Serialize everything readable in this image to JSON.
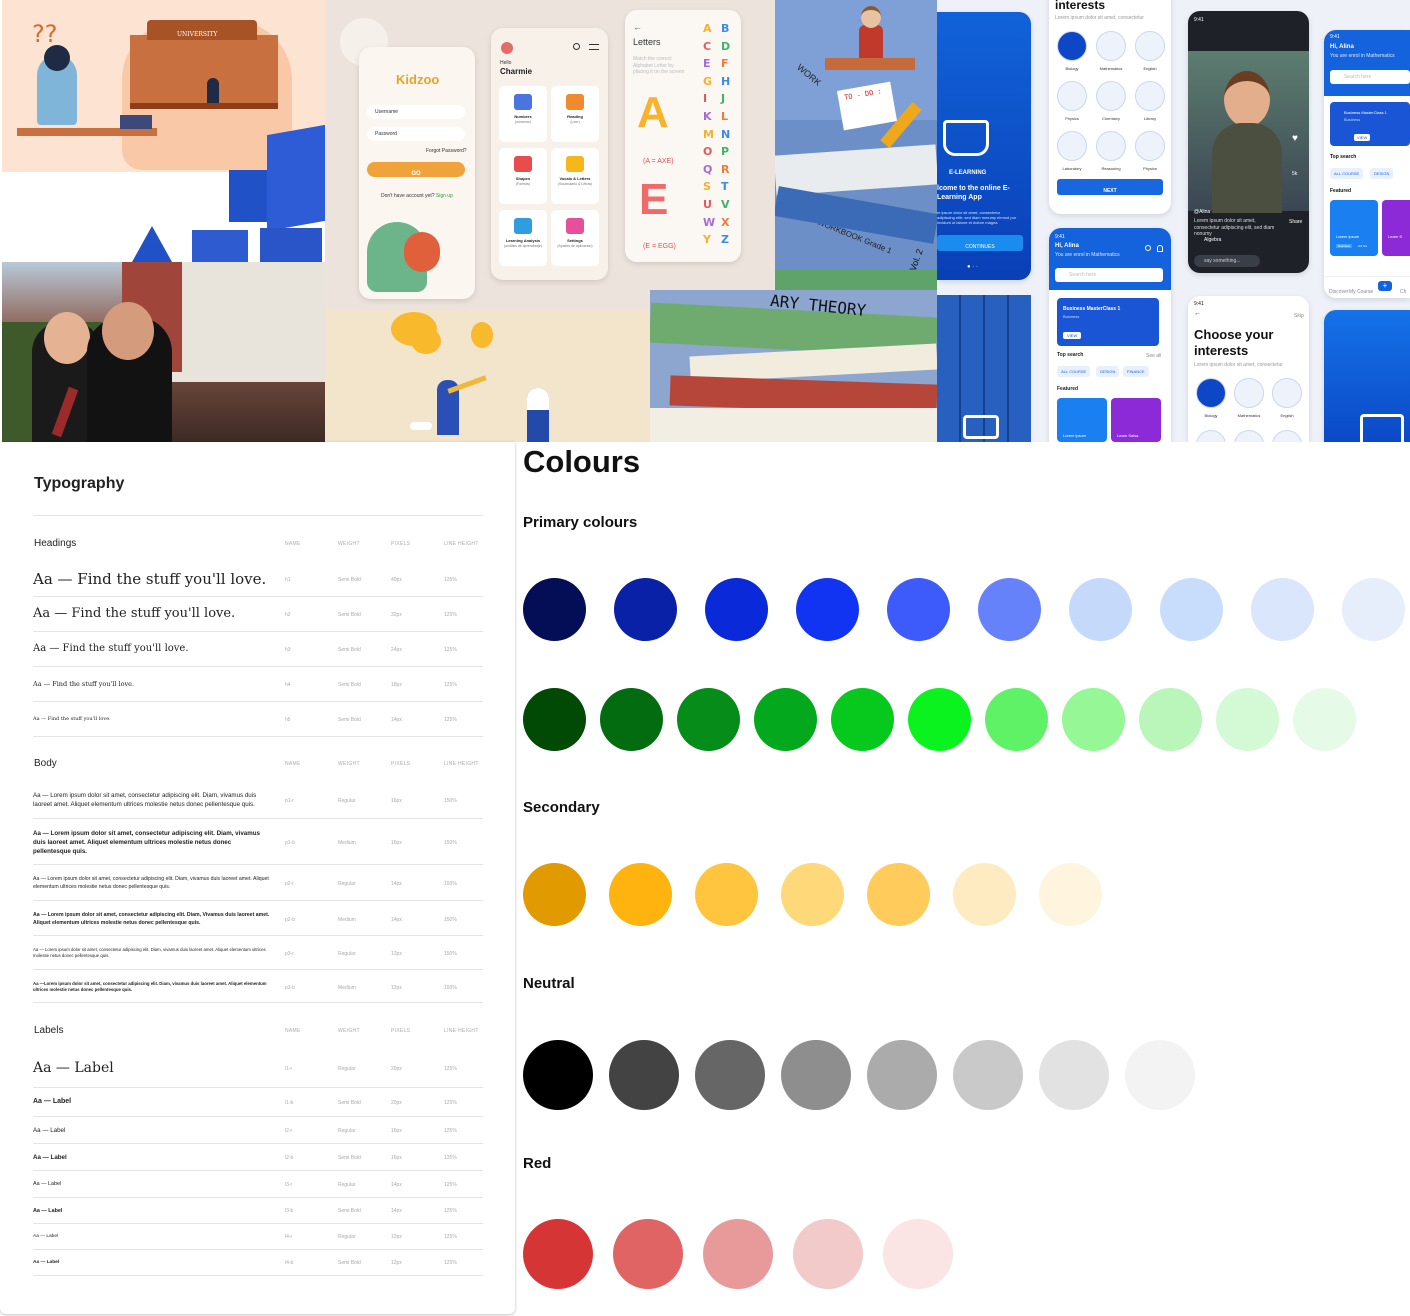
{
  "collage": {
    "university_sign": "UNIVERSITY",
    "kidzoo": {
      "logo": "Kidzoo",
      "username": "Username",
      "password": "Password",
      "forgot": "Forgot Password?",
      "go": "GO",
      "no_account": "Don't have account yet?",
      "sign_up": "Sign up"
    },
    "charmie": {
      "hello": "Hello",
      "name": "Charmie",
      "cards": [
        {
          "title": "Numbers",
          "sub": "(números)"
        },
        {
          "title": "Reading",
          "sub": "(Leer)"
        },
        {
          "title": "Shapes",
          "sub": "(Formas)"
        },
        {
          "title": "Vocals & Letters",
          "sub": "(Vocabulario & Letras)"
        },
        {
          "title": "Learning Analysis",
          "sub": "(análisis de aprendizaje)"
        },
        {
          "title": "Settings",
          "sub": "(Ajustes de aplicacion)"
        }
      ]
    },
    "letters": {
      "title": "Letters",
      "desc": "Match the correct Alphabet Letter by placing it on the screen",
      "axe": "(A = AXE)",
      "egg": "(E = EGG)",
      "grid": "ABCDEFGHIJKLMNOPQRSTUVWXYZ",
      "big_a": "A",
      "big_e": "E"
    },
    "sketch": {
      "todo": "TO - DO :",
      "work": "WORK",
      "theory": "ARY THEORY",
      "workbook": "WORKBOOK Grade 1",
      "vol": "Vol. 2"
    },
    "elearning": {
      "brand": "E-LEARNING",
      "welcome": "lcome to the online E- Learning App",
      "body": "m ipsum dolor sit amet, consectetur adipiscing elitr, sed diam nonumy eirmod por invidunt ut labore et dolore magna",
      "cta": "CONTINUES"
    },
    "interests": {
      "title": "interests",
      "sub": "Lorem ipsum dolor sit amet, consectetur",
      "items": [
        "Biology",
        "Mathematics",
        "English",
        "Physics",
        "Chemistry",
        "Library",
        "Laboratory",
        "Reasoning",
        "Physics"
      ],
      "next": "NEXT"
    },
    "home": {
      "time": "9:41",
      "greet": "Hi, Alina",
      "sub": "You are enrol in Mathematics",
      "search": "Search here",
      "banner": "Business MasterClass 1",
      "banner_sub": "Business",
      "view": "VIEW",
      "top_search": "Top search",
      "see_all": "See all",
      "chips": [
        "ALL COURSE",
        "DESIGN",
        "FINANCE"
      ],
      "featured": "Featured",
      "cards": [
        "Lorem ipsum",
        "Learn Salsa"
      ]
    },
    "video": {
      "time": "9:41",
      "user": "@Alina",
      "caption": "Lorem ipsum dolor sit amet, consectetur adipiscing elit, sed diam nonumy",
      "tag": "Algebra",
      "comment": "say something...",
      "likes": "5k",
      "share": "Share"
    },
    "choose": {
      "time": "9:41",
      "skip": "Skip",
      "title": "Choose your interests",
      "sub": "Lorem ipsum dolor sit amet, consectetur",
      "items": [
        "Biology",
        "Mathematics",
        "English"
      ]
    },
    "home2": {
      "time": "9:41",
      "greet": "Hi, Alina",
      "sub": "You are enrol in Mathematics",
      "search": "Search here",
      "banner": "Business MasterClass 1",
      "banner_sub": "Business",
      "view": "VIEW",
      "top_search": "Top search",
      "chips": [
        "ALL COURSE",
        "DESIGN"
      ],
      "featured": "Featured",
      "cards": [
        "Lorem ipsum",
        "Learn S"
      ],
      "card_meta": [
        "Business",
        "2/4 hrs"
      ],
      "nav": [
        "Discover",
        "My Course",
        "Ch"
      ]
    }
  },
  "typography": {
    "title": "Typography",
    "cols": [
      "NAME",
      "WEIGHT",
      "PIXELS",
      "LINE HEIGHT"
    ],
    "headings_label": "Headings",
    "headings": [
      {
        "text": "Aa — Find the stuff you'll love.",
        "name": "h1",
        "weight": "Semi Bold",
        "px": "40px",
        "lh": "125%"
      },
      {
        "text": "Aa — Find the stuff you'll love.",
        "name": "h2",
        "weight": "Semi Bold",
        "px": "32px",
        "lh": "125%"
      },
      {
        "text": "Aa — Find the stuff you'll love.",
        "name": "h3",
        "weight": "Semi Bold",
        "px": "24px",
        "lh": "125%"
      },
      {
        "text": "Aa — Find the stuff you'll love.",
        "name": "h4",
        "weight": "Semi Bold",
        "px": "18px",
        "lh": "125%"
      },
      {
        "text": "Aa — Find the stuff you'll love.",
        "name": "h5",
        "weight": "Semi Bold",
        "px": "14px",
        "lh": "125%"
      }
    ],
    "body_label": "Body",
    "body": [
      {
        "text": "Aa — Lorem ipsum dolor sit amet, consectetur adipiscing elit. Diam, vivamus duis laoreet amet. Aliquet elementum ultrices molestie netus donec pellentesque quis.",
        "name": "p1-r",
        "weight": "Regular",
        "px": "16px",
        "lh": "150%"
      },
      {
        "text": "Aa — Lorem ipsum dolor sit amet, consectetur adipiscing elit. Diam, vivamus duis laoreet amet. Aliquet elementum ultrices molestie netus donec pellentesque quis.",
        "name": "p1-b",
        "weight": "Medium",
        "px": "16px",
        "lh": "150%"
      },
      {
        "text": "Aa — Lorem ipsum dolor sit amet, consectetur adipiscing elit. Diam, vivamus duis laoreet amet. Aliquet elementum ultrices molestie netus donec pellentesque quis.",
        "name": "p2-r",
        "weight": "Regular",
        "px": "14px",
        "lh": "150%"
      },
      {
        "text": "Aa — Lorem ipsum dolor sit amet, consectetur adipiscing elit. Diam, Vivamus duis laoreet amet. Aliquet elementum ultrices molestie netus donec pellentesque quis.",
        "name": "p2-b",
        "weight": "Medium",
        "px": "14px",
        "lh": "150%"
      },
      {
        "text": "Aa — Lorem ipsum dolor sit amet, consectetur adipiscing elit. Diam, vivamus duis laoreet amet. Aliquet elementum ultrices molestie netus donec pellentesque quis.",
        "name": "p3-r",
        "weight": "Regular",
        "px": "12px",
        "lh": "150%"
      },
      {
        "text": "Aa —Lorem ipsum dolor sit amet, consectetur adipiscing elit. Diam, vivamus duis laoreet amet. Aliquet elementum ultrices molestie netus donec pellentesque quis.",
        "name": "p3-b",
        "weight": "Medium",
        "px": "12px",
        "lh": "150%"
      }
    ],
    "labels_label": "Labels",
    "labels": [
      {
        "text": "Aa — Label",
        "name": "l1-r",
        "weight": "Regular",
        "px": "20px",
        "lh": "125%"
      },
      {
        "text": "Aa — Label",
        "name": "l1-b",
        "weight": "Semi Bold",
        "px": "20px",
        "lh": "125%"
      },
      {
        "text": "Aa — Label",
        "name": "l2-r",
        "weight": "Regular",
        "px": "16px",
        "lh": "125%"
      },
      {
        "text": "Aa — Label",
        "name": "l2-b",
        "weight": "Semi Bold",
        "px": "16px",
        "lh": "125%"
      },
      {
        "text": "Aa — Label",
        "name": "l3-r",
        "weight": "Regular",
        "px": "14px",
        "lh": "125%"
      },
      {
        "text": "Aa — Label",
        "name": "l3-b",
        "weight": "Semi Bold",
        "px": "14px",
        "lh": "125%"
      },
      {
        "text": "Aa — Label",
        "name": "l4-r",
        "weight": "Regular",
        "px": "12px",
        "lh": "125%"
      },
      {
        "text": "Aa — Label",
        "name": "l4-b",
        "weight": "Semi Bold",
        "px": "12px",
        "lh": "125%"
      }
    ]
  },
  "colours": {
    "title": "Colours",
    "sections": [
      {
        "label": "Primary colours",
        "rows": [
          [
            "#030E57",
            "#0821A6",
            "#0A29D8",
            "#1133F2",
            "#3D5BFA",
            "#6582FA",
            "#C5DAFB",
            "#C8DCFC",
            "#DAE6FC",
            "#E6EEFC"
          ],
          [
            "#014A06",
            "#036B10",
            "#058C19",
            "#04A81C",
            "#06C81D",
            "#0AF31E",
            "#5FF267",
            "#95F796",
            "#BAF6BA",
            "#D4F9D5",
            "#E6FBE7"
          ]
        ]
      },
      {
        "label": "Secondary",
        "rows": [
          [
            "#E19A00",
            "#FEB30F",
            "#FFC53F",
            "#FFD87A",
            "#FFCC5C",
            "#FFEBC2",
            "#FFF4DE"
          ]
        ]
      },
      {
        "label": "Neutral",
        "rows": [
          [
            "#000000",
            "#434343",
            "#666666",
            "#8E8E8E",
            "#ABABAB",
            "#C9C9C9",
            "#E2E2E2",
            "#F3F3F3"
          ]
        ]
      },
      {
        "label": "Red",
        "rows": [
          [
            "#D63535",
            "#E06464",
            "#E89A9A",
            "#F2CACA",
            "#FAE4E4"
          ]
        ]
      }
    ]
  }
}
